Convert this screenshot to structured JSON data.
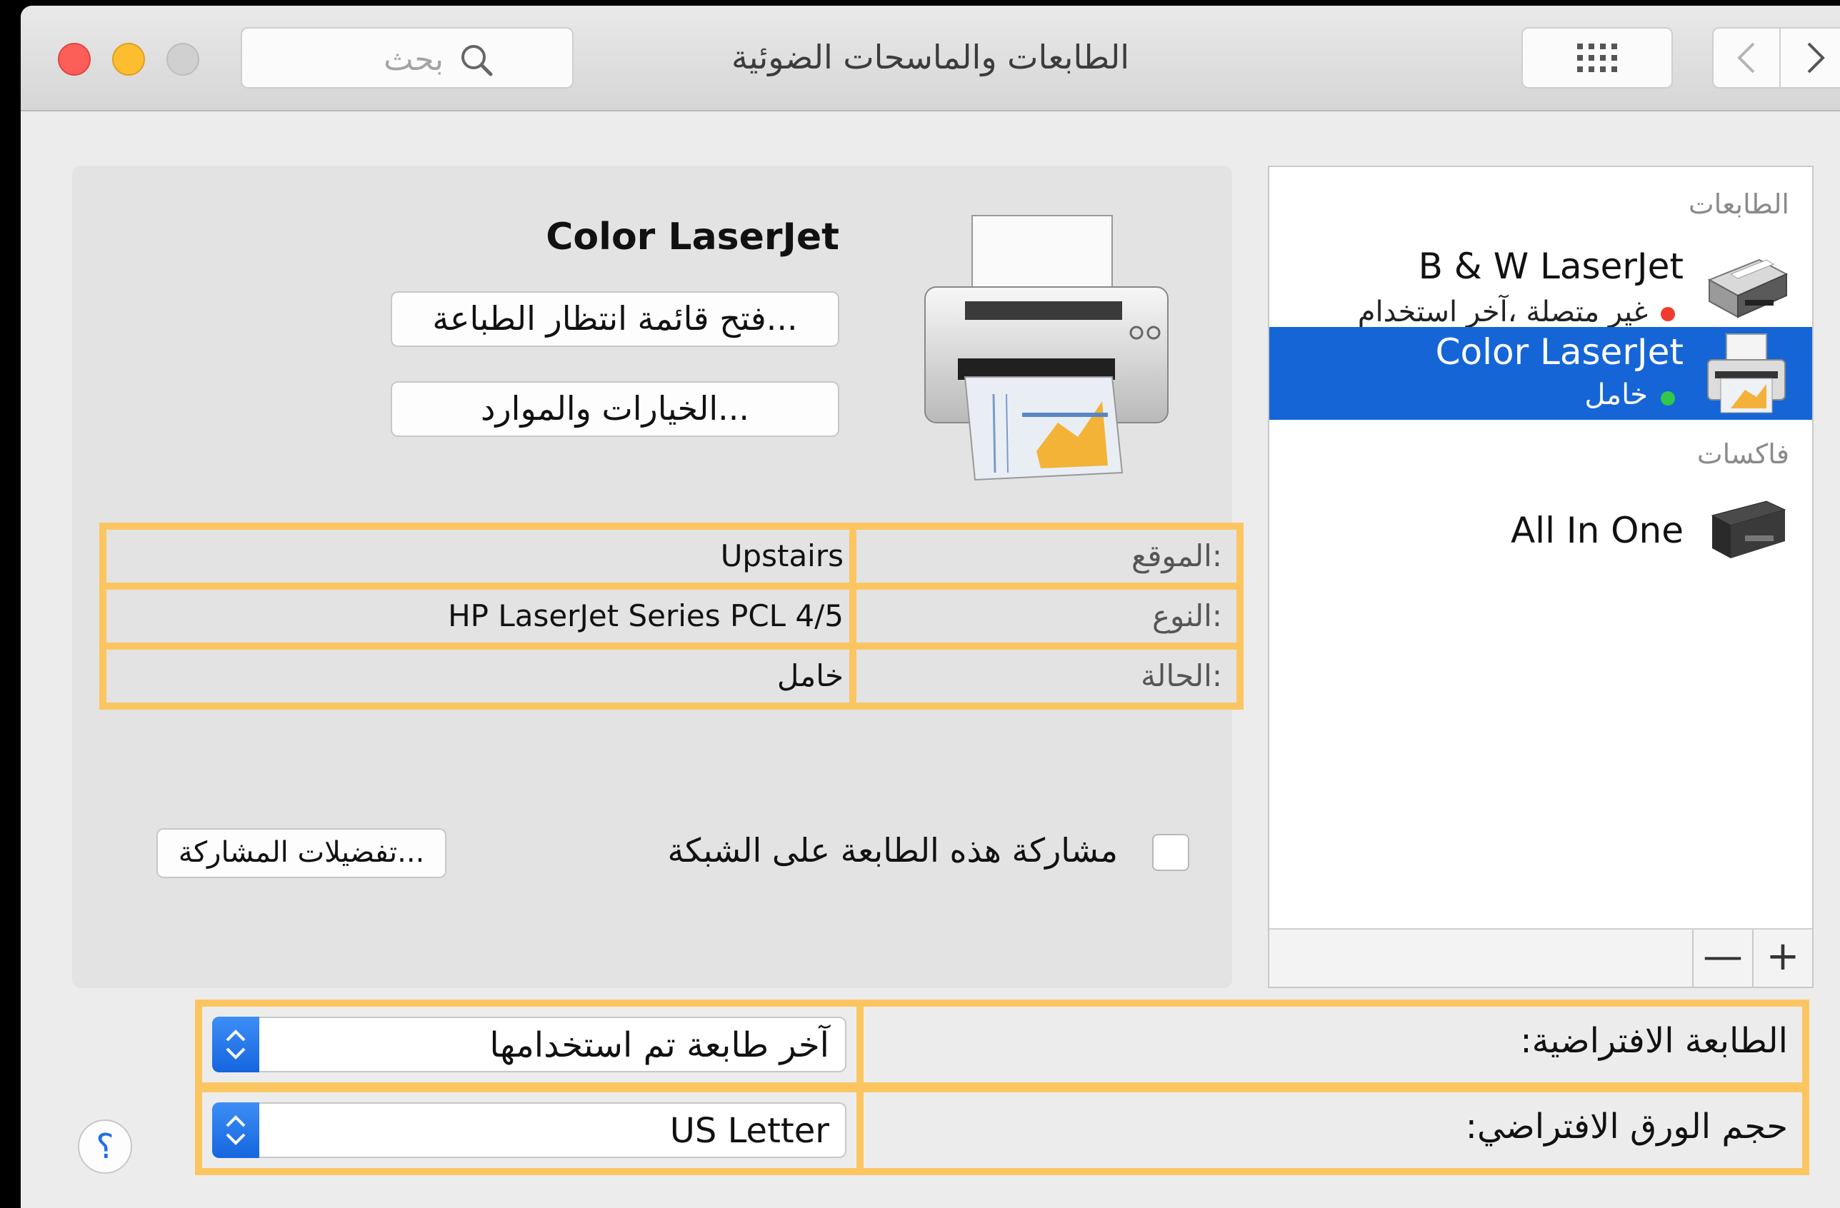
{
  "window": {
    "title": "الطابعات والماسحات الضوئية",
    "search_placeholder": "بحث"
  },
  "sidebar": {
    "printers_header": "الطابعات",
    "faxes_header": "فاكسات",
    "items": [
      {
        "name": "B & W LaserJet",
        "status": "غير متصلة ،آخر استخدام",
        "status_color": "#f23b30",
        "selected": false
      },
      {
        "name": "Color LaserJet",
        "status": "خامل",
        "status_color": "#31c84a",
        "selected": true
      }
    ],
    "faxes": [
      {
        "name": "All In One"
      }
    ],
    "add_label": "+",
    "remove_label": "—"
  },
  "detail": {
    "printer_name": "Color LaserJet",
    "open_queue_label": "فتح قائمة انتظار الطباعة...",
    "options_label": "الخيارات والموارد...",
    "location_label": "الموقع:",
    "location_value": "Upstairs",
    "kind_label": "النوع:",
    "kind_value": "HP LaserJet Series PCL 4/5",
    "status_label": "الحالة:",
    "status_value": "خامل",
    "share_label": "مشاركة هذه الطابعة على الشبكة",
    "share_checked": false,
    "sharing_prefs_label": "تفضيلات المشاركة..."
  },
  "settings": {
    "default_printer_label": "الطابعة الافتراضية:",
    "default_printer_value": "آخر طابعة تم استخدامها",
    "default_paper_label": "حجم الورق الافتراضي:",
    "default_paper_value": "US Letter"
  },
  "help_label": "؟",
  "colors": {
    "selection": "#1565d6",
    "highlight_border": "#fbc661"
  }
}
